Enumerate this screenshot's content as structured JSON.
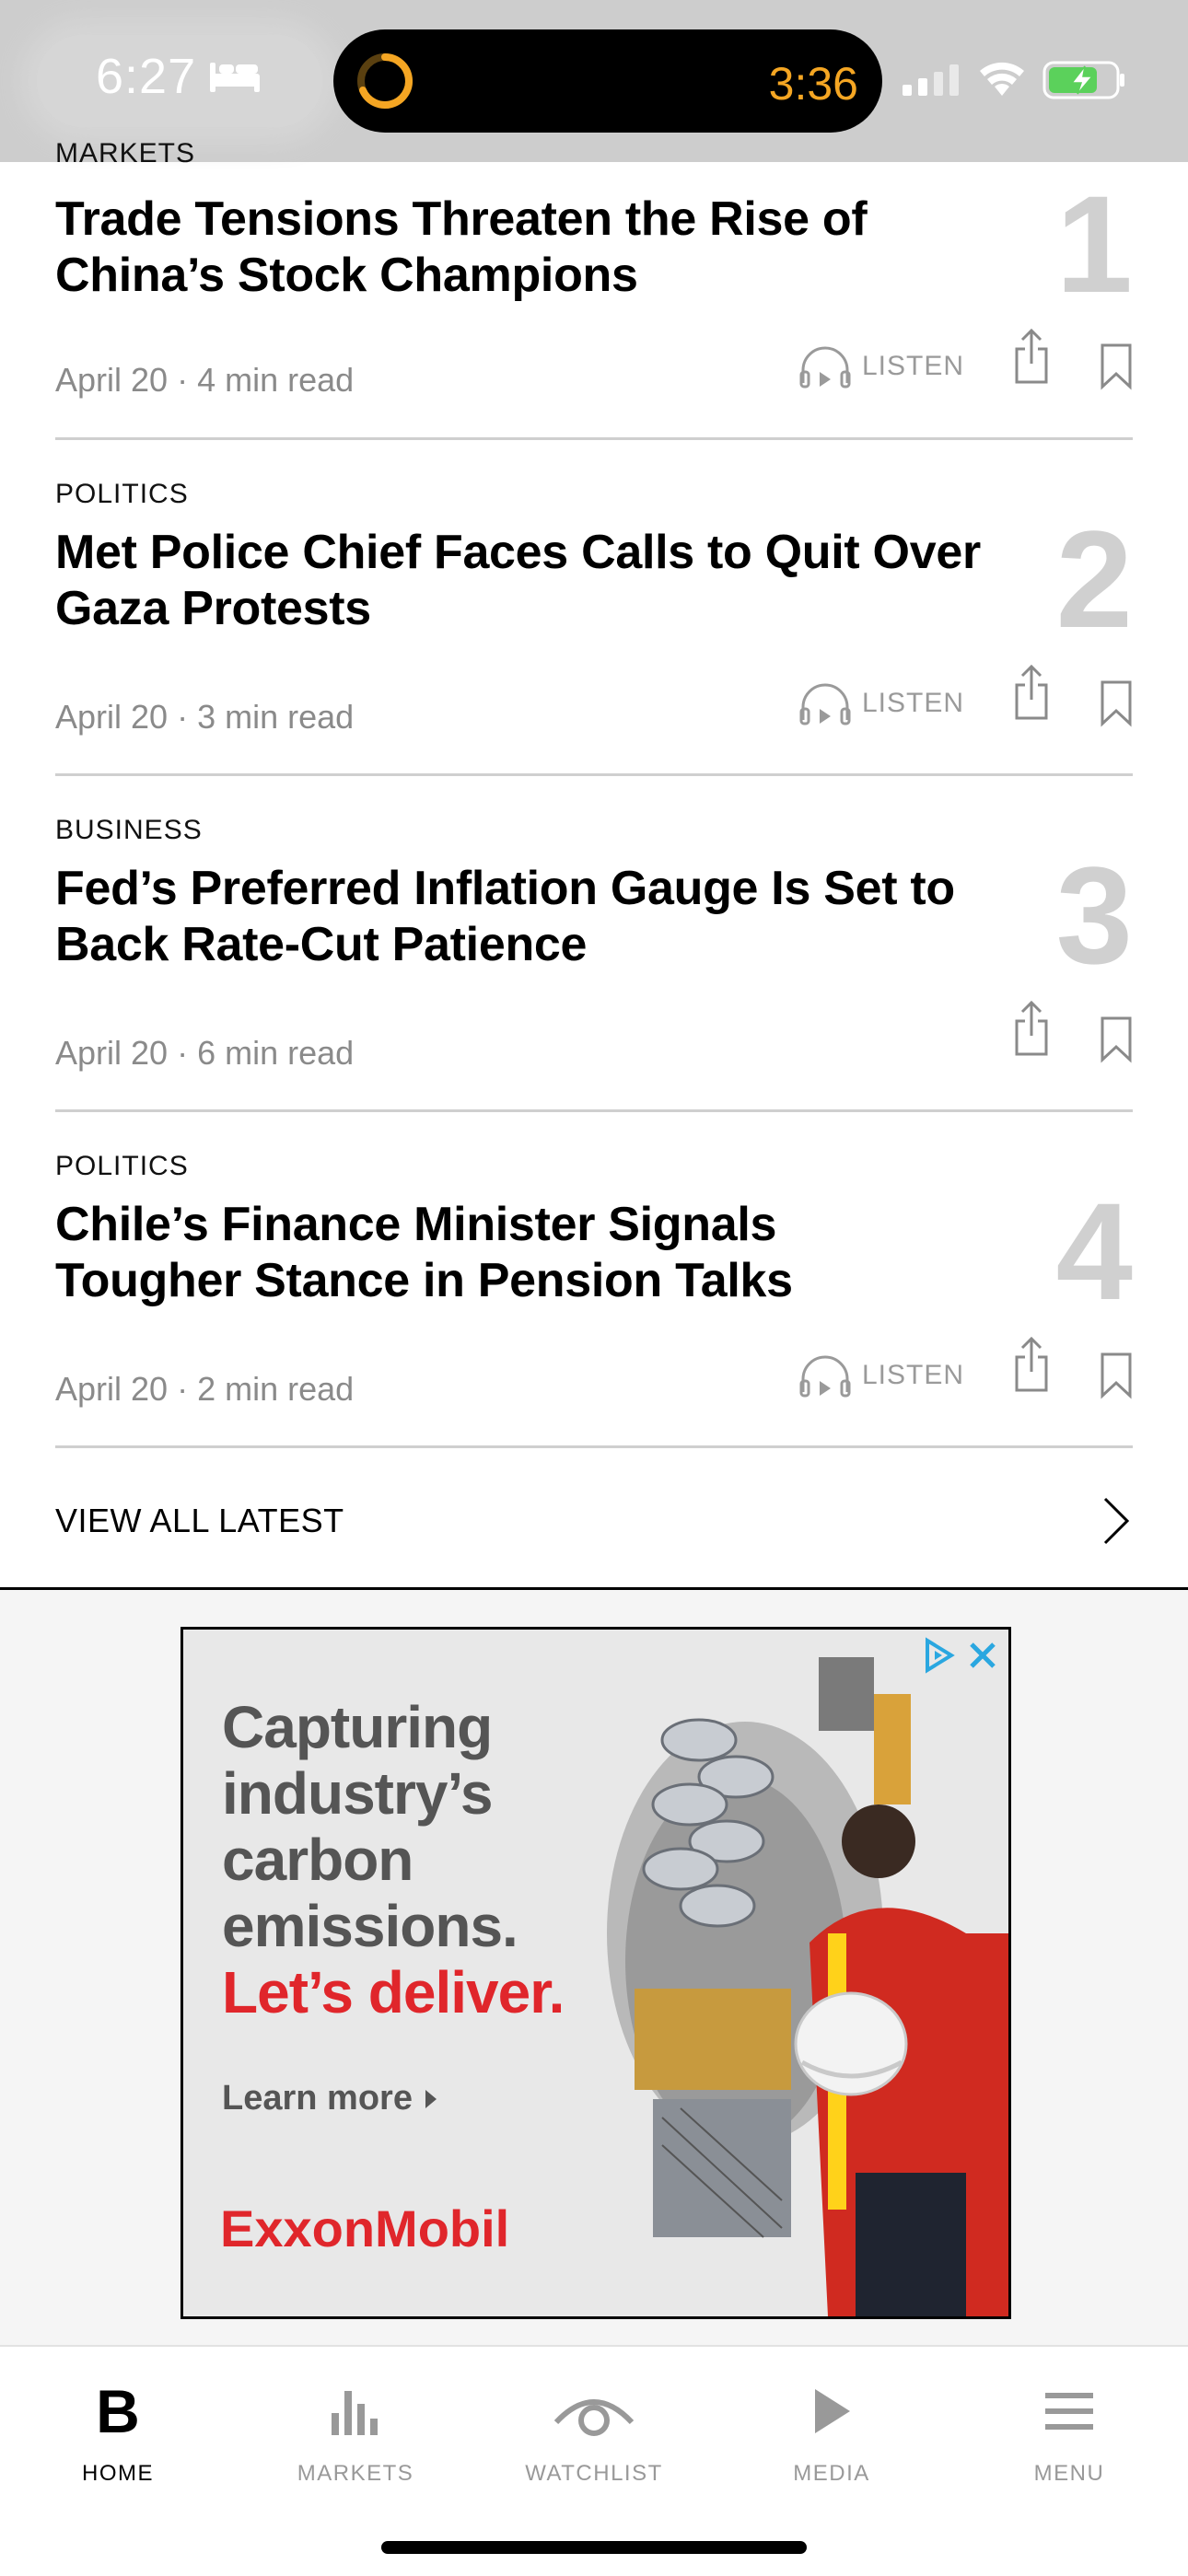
{
  "status_bar": {
    "time": "6:27",
    "timer_time": "3:36",
    "timer_color": "#f5a623"
  },
  "articles": [
    {
      "category": "MARKETS",
      "title": "Trade Tensions Threaten the Rise of China’s Stock Champions",
      "rank": "1",
      "date": "April 20",
      "read_time": "4 min read",
      "listen_label": "LISTEN"
    },
    {
      "category": "POLITICS",
      "title": "Met Police Chief Faces Calls to Quit Over Gaza Protests",
      "rank": "2",
      "date": "April 20",
      "read_time": "3 min read",
      "listen_label": "LISTEN"
    },
    {
      "category": "BUSINESS",
      "title": "Fed’s Preferred Inflation Gauge Is Set to Back Rate-Cut Patience",
      "rank": "3",
      "date": "April 20",
      "read_time": "6 min read"
    },
    {
      "category": "POLITICS",
      "title": "Chile’s Finance Minister Signals Tougher Stance in Pension Talks",
      "rank": "4",
      "date": "April 20",
      "read_time": "2 min read",
      "listen_label": "LISTEN"
    }
  ],
  "meta_separator": "·",
  "view_all": {
    "label": "VIEW ALL LATEST"
  },
  "ad": {
    "line1": "Capturing",
    "line2": "industry’s",
    "line3": "carbon",
    "line4": "emissions.",
    "cta": "Let’s deliver.",
    "learn_more": "Learn more",
    "brand": "ExxonMobil",
    "brand_color": "#e0262b"
  },
  "tab_bar": {
    "tabs": [
      {
        "label": "HOME",
        "icon": "home-b-icon",
        "active": true
      },
      {
        "label": "MARKETS",
        "icon": "bar-chart-icon"
      },
      {
        "label": "WATCHLIST",
        "icon": "eye-icon"
      },
      {
        "label": "MEDIA",
        "icon": "play-icon"
      },
      {
        "label": "MENU",
        "icon": "hamburger-icon"
      }
    ],
    "home_glyph": "B"
  }
}
